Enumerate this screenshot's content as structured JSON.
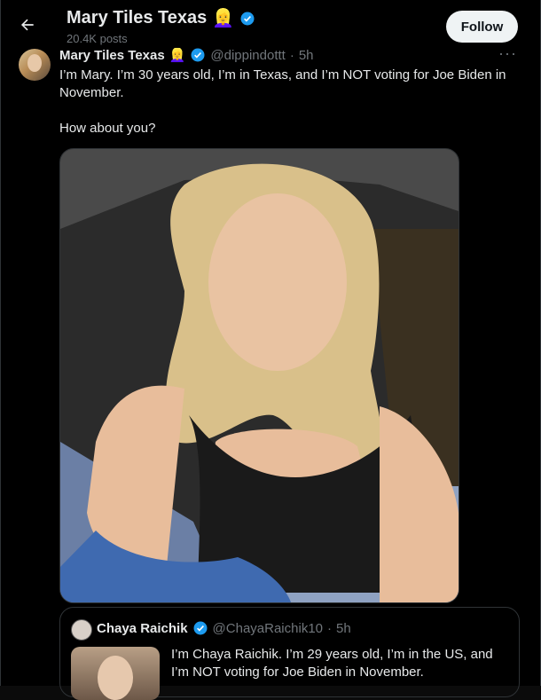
{
  "header": {
    "back_icon": "arrow-left-icon",
    "title": "Mary Tiles Texas",
    "title_emoji": "👱‍♀️",
    "posts": "20.4K posts",
    "follow_label": "Follow"
  },
  "post": {
    "name": "Mary Tiles Texas",
    "name_emoji": "👱‍♀️",
    "handle": "@dippindottt",
    "sep": "·",
    "time": "5h",
    "more_icon": "more-icon",
    "text": "I’m Mary. I’m 30 years old, I’m in Texas, and I’m NOT voting for Joe Biden in November.\n\nHow about you?"
  },
  "quote": {
    "name": "Chaya Raichik",
    "handle": "@ChayaRaichik10",
    "sep": "·",
    "time": "5h",
    "text": "I’m Chaya Raichik. I’m 29 years old, I’m in the US, and\nI’m NOT voting for Joe Biden in November."
  },
  "colors": {
    "background": "#000000",
    "text": "#e7e9ea",
    "secondary": "#71767b",
    "verified": "#1d9bf0",
    "border": "#2f3336"
  }
}
